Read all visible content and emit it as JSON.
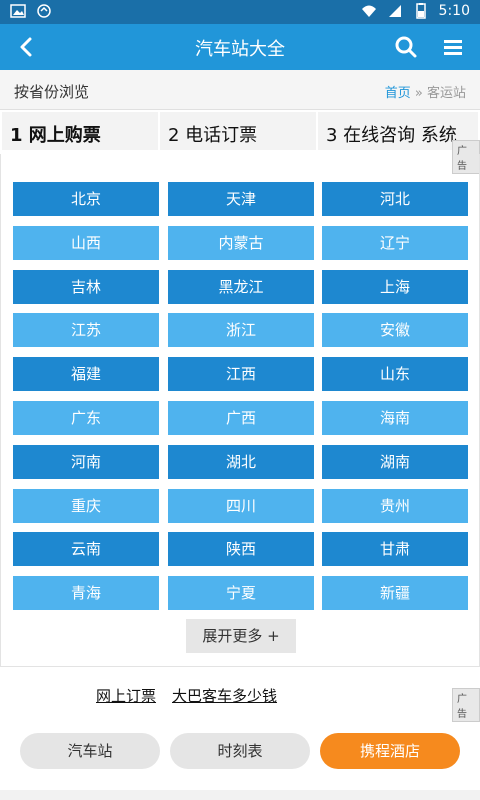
{
  "status_bar": {
    "time": "5:10",
    "icons": [
      "image-notification-icon",
      "sync-notification-icon",
      "wifi-icon",
      "signal-icon",
      "battery-icon"
    ]
  },
  "app_bar": {
    "title": "汽车站大全",
    "back_icon": "back-arrow-icon",
    "search_icon": "search-icon",
    "menu_icon": "hamburger-menu-icon"
  },
  "breadcrumb_bar": {
    "label": "按省份浏览",
    "home": "首页",
    "separator": "»",
    "current": "客运站"
  },
  "ad_links": {
    "items": [
      "1  网上购票",
      "2  电话订票",
      "3  在线咨询 系统"
    ],
    "ad_tag": "广告"
  },
  "provinces": [
    "北京",
    "天津",
    "河北",
    "山西",
    "内蒙古",
    "辽宁",
    "吉林",
    "黑龙江",
    "上海",
    "江苏",
    "浙江",
    "安徽",
    "福建",
    "江西",
    "山东",
    "广东",
    "广西",
    "海南",
    "河南",
    "湖北",
    "湖南",
    "重庆",
    "四川",
    "贵州",
    "云南",
    "陕西",
    "甘肃",
    "青海",
    "宁夏",
    "新疆"
  ],
  "expand_more": "展开更多 +",
  "footer_links": {
    "items": [
      "网上订票",
      "大巴客车多少钱"
    ],
    "ad_tag": "广告"
  },
  "bottom_pills": [
    "汽车站",
    "时刻表",
    "携程酒店"
  ],
  "colors": {
    "status_bar": "#1a6fa8",
    "app_bar": "#2196d9",
    "cell_dark": "#1e88d0",
    "cell_light": "#4fb3ee",
    "accent_orange": "#f68a1e"
  }
}
